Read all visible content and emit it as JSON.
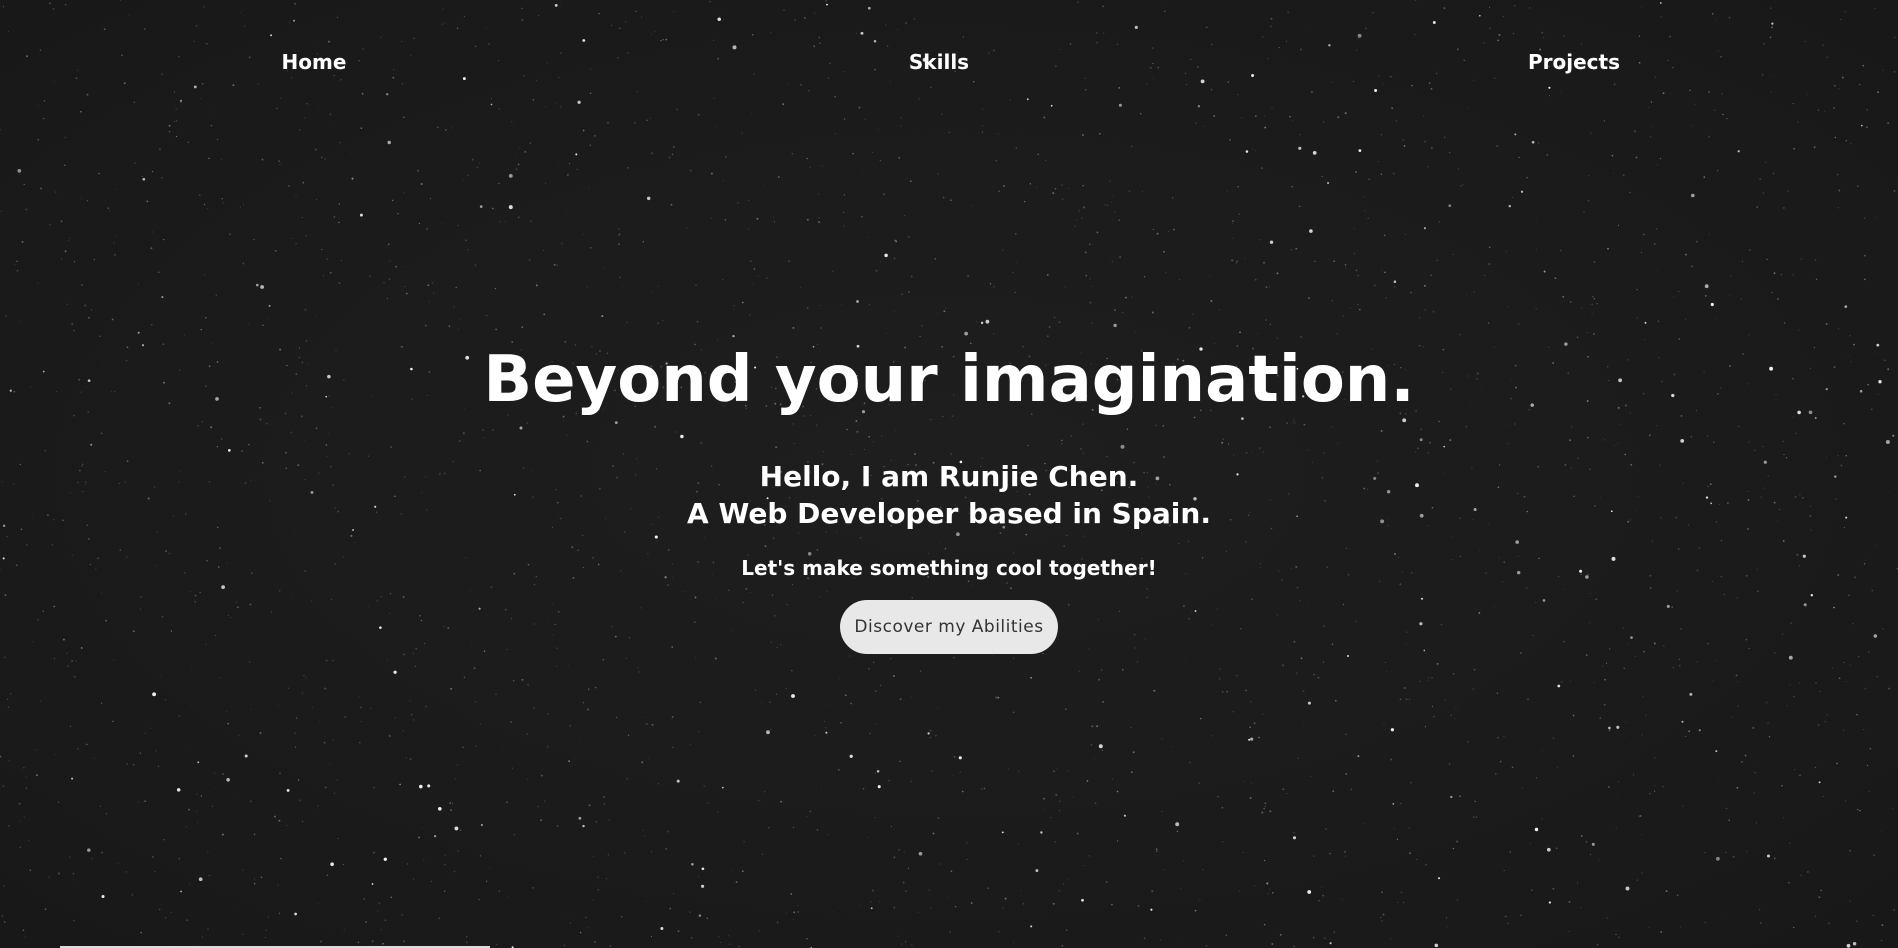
{
  "nav": {
    "home": "Home",
    "skills": "Skills",
    "projects": "Projects"
  },
  "hero": {
    "title": "Beyond your imagination.",
    "subtitle_line1": "Hello, I am Runjie Chen.",
    "subtitle_line2": "A Web Developer based in Spain.",
    "tagline": "Let's make something cool together!",
    "cta_label": "Discover my Abilities"
  },
  "colors": {
    "background": "#1a1a1a",
    "text": "#ffffff",
    "button_bg": "#e8e8e8",
    "button_text": "#333333"
  }
}
